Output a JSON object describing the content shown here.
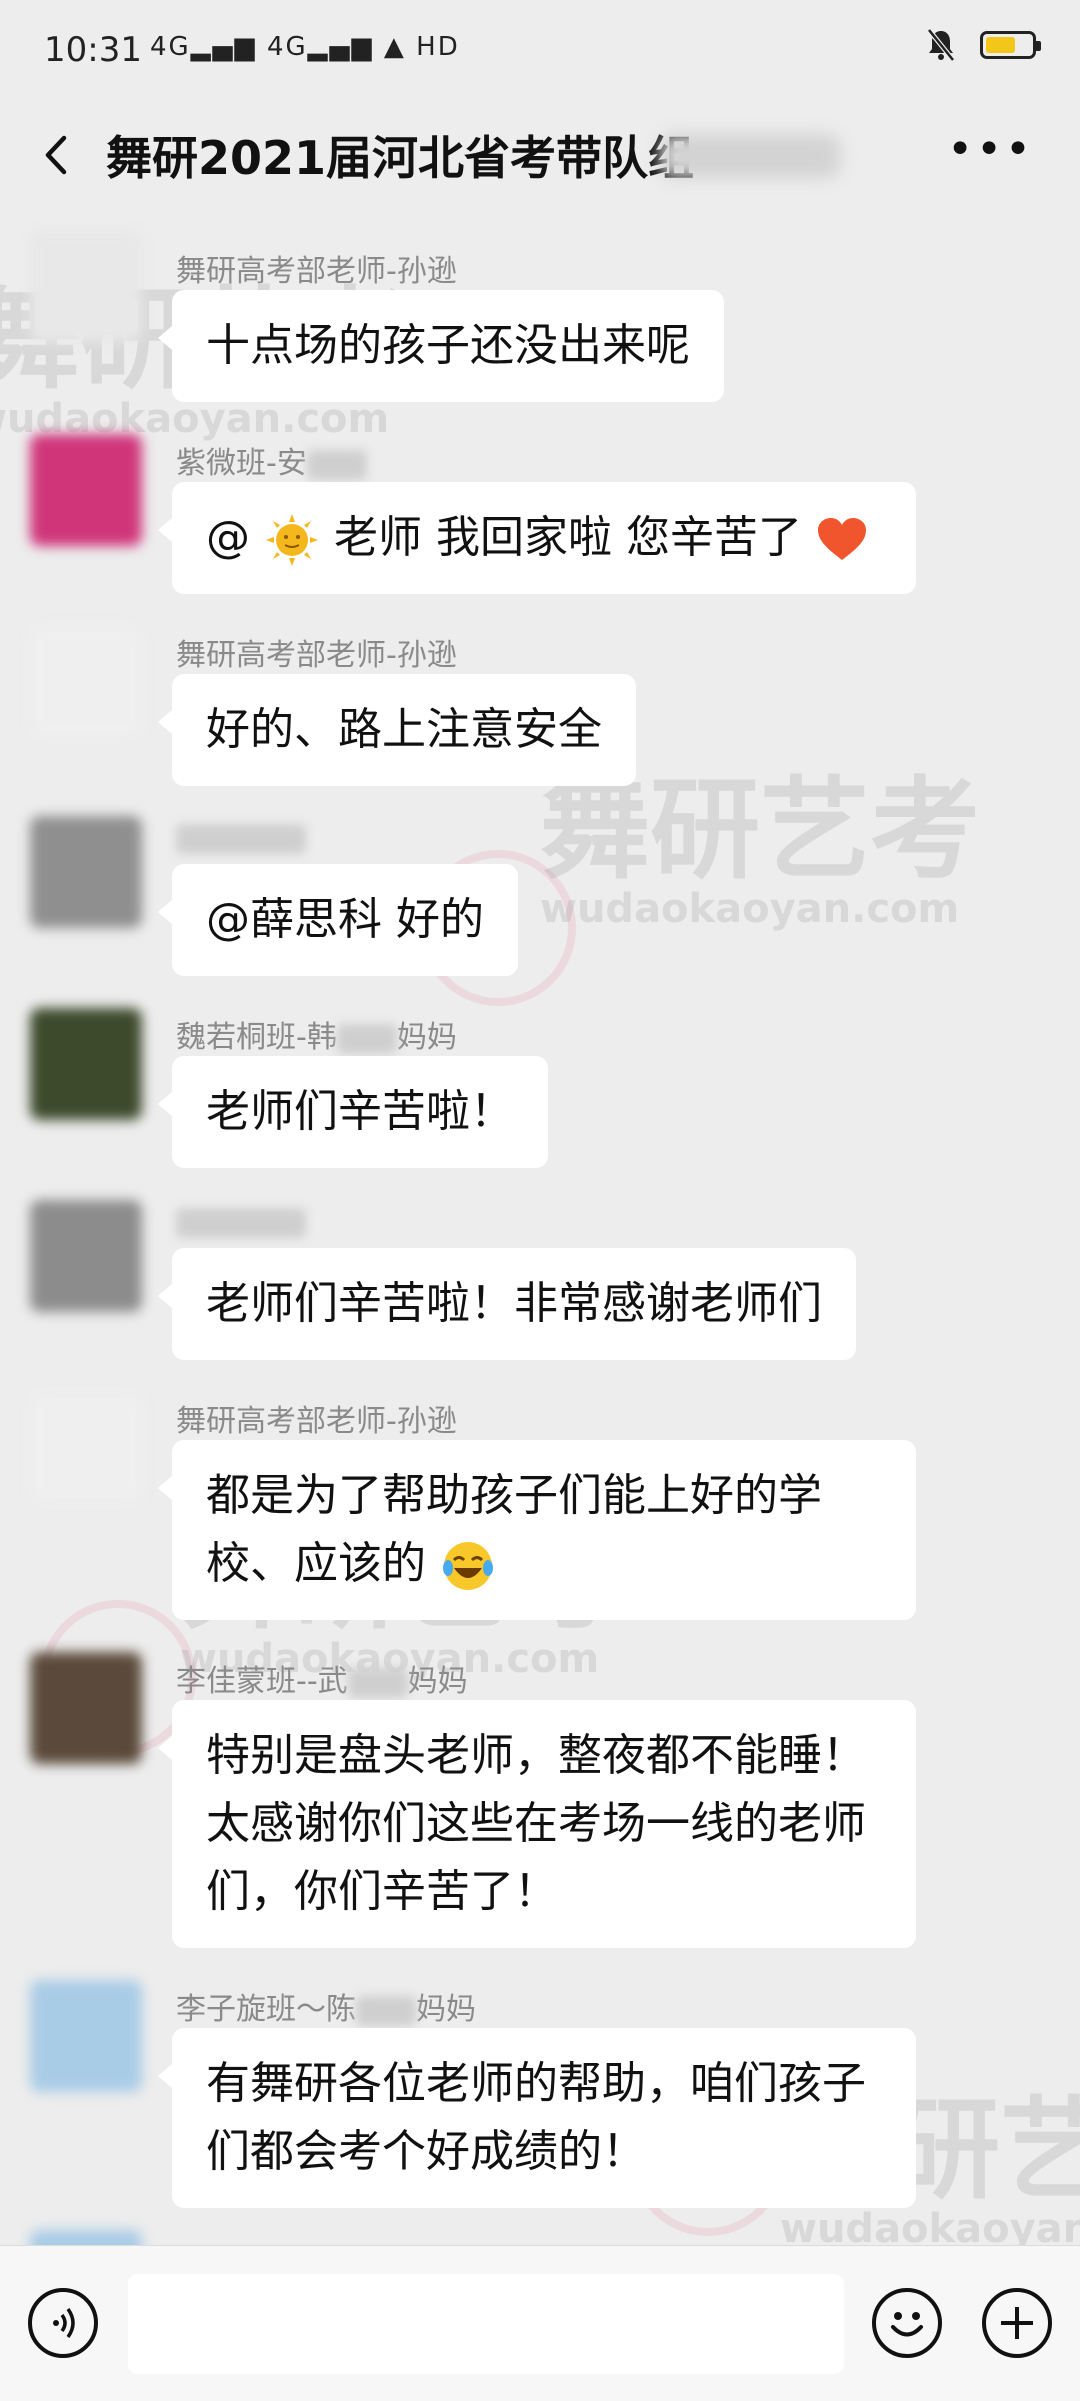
{
  "status_bar": {
    "time": "10:31",
    "signals": "4G▂▄▆ 4G▂▄▆ ▲ HD"
  },
  "header": {
    "title": "舞研2021届河北省考带队组"
  },
  "messages": [
    {
      "sender": "舞研高考部老师-孙逊",
      "text": "十点场的孩子还没出来呢"
    },
    {
      "sender": "紫微班-安",
      "text_parts": [
        "@",
        "老师 我回家啦 您辛苦了"
      ]
    },
    {
      "sender": "舞研高考部老师-孙逊",
      "text": "好的、路上注意安全"
    },
    {
      "sender": "",
      "text": "@薛思科  好的"
    },
    {
      "sender_parts": [
        "魏若桐班-韩",
        "妈妈"
      ],
      "text": "老师们辛苦啦！"
    },
    {
      "sender": "",
      "text": "老师们辛苦啦！非常感谢老师们"
    },
    {
      "sender": "舞研高考部老师-孙逊",
      "text": "都是为了帮助孩子们能上好的学校、应该的"
    },
    {
      "sender_parts": [
        "李佳蒙班--武",
        "妈妈"
      ],
      "text": "特别是盘头老师，整夜都不能睡！太感谢你们这些在考场一线的老师们，你们辛苦了！"
    },
    {
      "sender_parts": [
        "李子旋班～陈",
        "妈妈"
      ],
      "text": "有舞研各位老师的帮助，咱们孩子们都会考个好成绩的！"
    }
  ],
  "watermark": {
    "cn": "舞研艺考",
    "en": "wudaokaoyan.com"
  },
  "colors": {
    "background": "#ededed",
    "bubble": "#ffffff",
    "battery": "#f2c71a"
  }
}
